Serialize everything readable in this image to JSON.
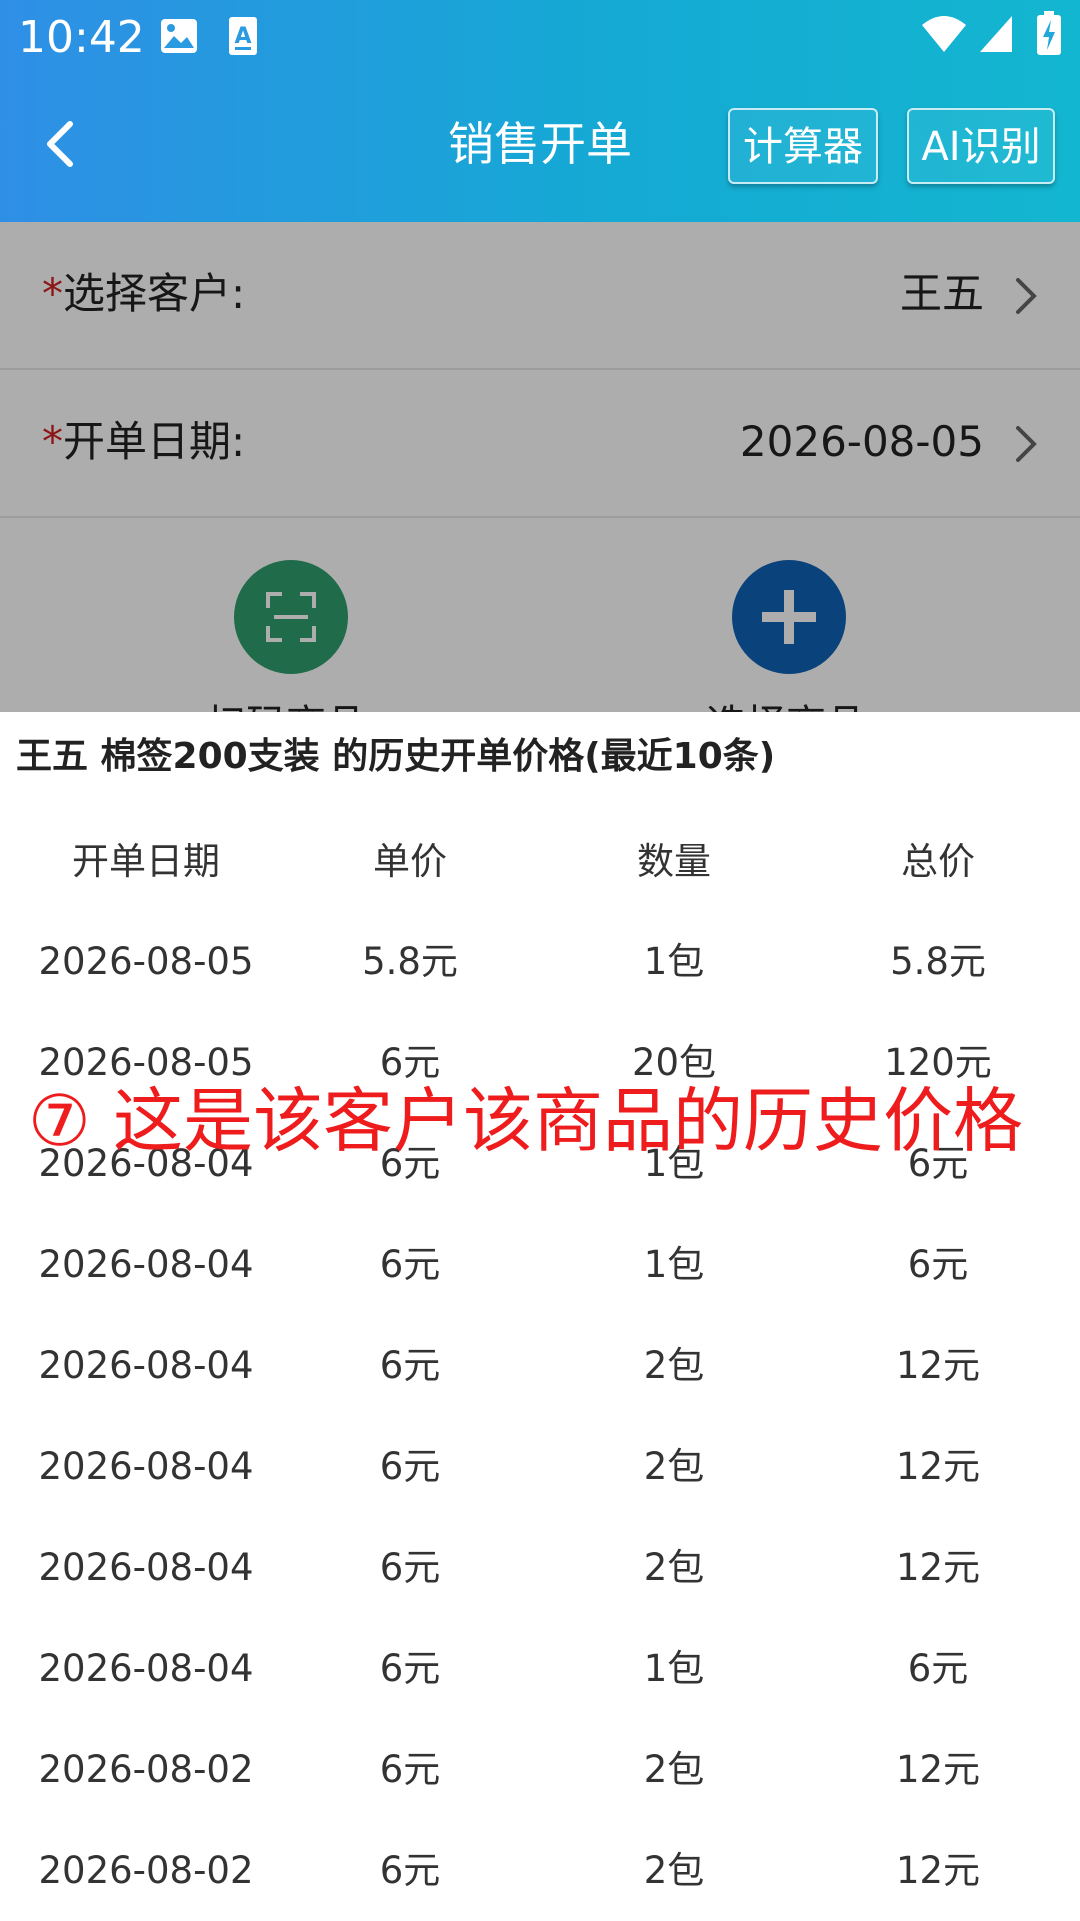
{
  "status_bar": {
    "time": "10:42",
    "left_icons": [
      "image-icon",
      "font-a-icon"
    ],
    "right_icons": [
      "wifi-icon",
      "signal-icon",
      "battery-charging-icon"
    ]
  },
  "header": {
    "title": "销售开单",
    "back_icon": "chevron-left-icon",
    "calculator_label": "计算器",
    "ai_label": "AI识别"
  },
  "form": {
    "customer": {
      "required_mark": "*",
      "label": "选择客户:",
      "value": "王五"
    },
    "date": {
      "required_mark": "*",
      "label": "开单日期:",
      "value": "2026-08-05"
    },
    "actions": {
      "scan": {
        "icon": "scan-icon",
        "label": "扫码商品",
        "color": "#2e9e6d"
      },
      "select": {
        "icon": "plus-icon",
        "label": "选择商品",
        "color": "#0f62b5"
      }
    }
  },
  "history": {
    "title": "王五  棉签200支装  的历史开单价格(最近10条)",
    "columns": [
      "开单日期",
      "单价",
      "数量",
      "总价"
    ],
    "rows": [
      [
        "2026-08-05",
        "5.8元",
        "1包",
        "5.8元"
      ],
      [
        "2026-08-05",
        "6元",
        "20包",
        "120元"
      ],
      [
        "2026-08-04",
        "6元",
        "1包",
        "6元"
      ],
      [
        "2026-08-04",
        "6元",
        "1包",
        "6元"
      ],
      [
        "2026-08-04",
        "6元",
        "2包",
        "12元"
      ],
      [
        "2026-08-04",
        "6元",
        "2包",
        "12元"
      ],
      [
        "2026-08-04",
        "6元",
        "2包",
        "12元"
      ],
      [
        "2026-08-04",
        "6元",
        "1包",
        "6元"
      ],
      [
        "2026-08-02",
        "6元",
        "2包",
        "12元"
      ],
      [
        "2026-08-02",
        "6元",
        "2包",
        "12元"
      ]
    ]
  },
  "annotation": "⑦ 这是该客户该商品的历史价格",
  "colors": {
    "header_gradient_start": "#2f8fe6",
    "header_gradient_end": "#13b6d0",
    "required": "#d02020",
    "annotation": "#ee1c1c"
  }
}
